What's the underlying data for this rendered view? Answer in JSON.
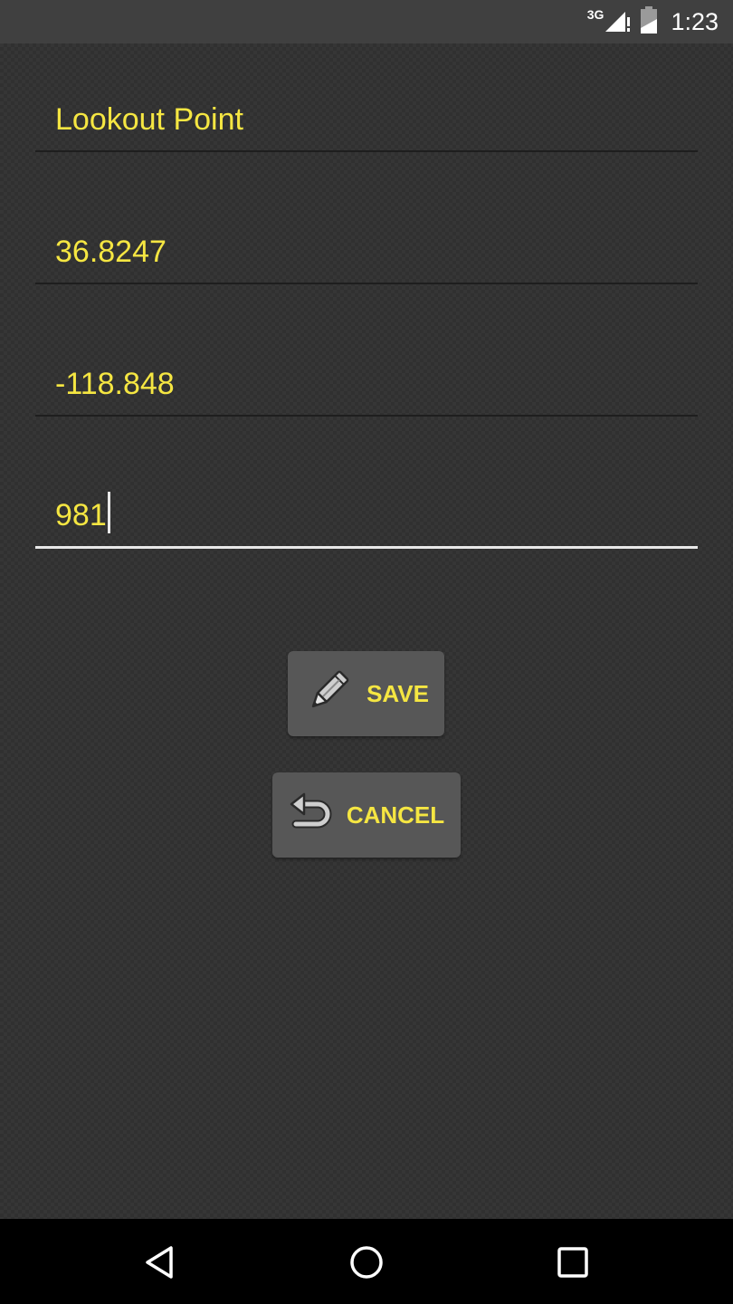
{
  "status_bar": {
    "network_label": "3G",
    "signal_icon": "signal-icon",
    "battery_icon": "battery-icon",
    "time": "1:23"
  },
  "form": {
    "name": {
      "value": "Lookout Point"
    },
    "latitude": {
      "value": "36.8247"
    },
    "longitude": {
      "value": "-118.848"
    },
    "elevation": {
      "value": "981",
      "focused": true
    }
  },
  "buttons": {
    "save": {
      "label": "SAVE",
      "icon": "pencil-icon"
    },
    "cancel": {
      "label": "CANCEL",
      "icon": "undo-icon"
    }
  },
  "nav": {
    "back_icon": "back-icon",
    "home_icon": "home-icon",
    "recents_icon": "recents-icon"
  },
  "colors": {
    "accent": "#f5e642",
    "background": "#363636",
    "button_bg": "#575757",
    "status_bar": "#404040",
    "nav_bar": "#000000"
  }
}
